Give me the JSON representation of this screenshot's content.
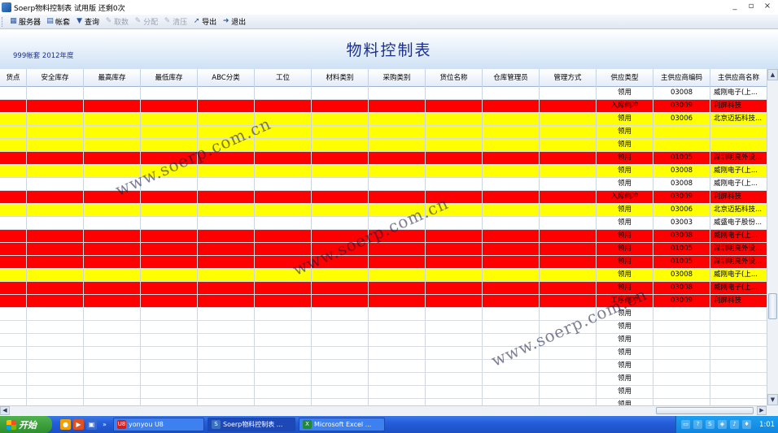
{
  "window": {
    "title": "Soerp物料控制表  试用版  还剩0次",
    "minimize": "_",
    "restore": "▫",
    "close": "×"
  },
  "toolbar": {
    "items": [
      {
        "label": "服务器",
        "icon": "server-icon",
        "glyph": "▦",
        "enabled": true
      },
      {
        "label": "帐套",
        "icon": "account-book-icon",
        "glyph": "▤",
        "enabled": true
      },
      {
        "label": "查询",
        "icon": "filter-icon",
        "glyph": "▼",
        "enabled": true
      },
      {
        "label": "取数",
        "icon": "fetch-data-icon",
        "glyph": "✎",
        "enabled": false
      },
      {
        "label": "分配",
        "icon": "allocate-icon",
        "glyph": "✎",
        "enabled": false
      },
      {
        "label": "清压",
        "icon": "clear-icon",
        "glyph": "✎",
        "enabled": false
      },
      {
        "label": "导出",
        "icon": "export-icon",
        "glyph": "➚",
        "enabled": true
      },
      {
        "label": "退出",
        "icon": "exit-icon",
        "glyph": "➜",
        "enabled": true
      }
    ]
  },
  "report": {
    "title": "物料控制表",
    "subtitle": "999帐套 2012年度"
  },
  "grid": {
    "columns": [
      "货点",
      "安全库存",
      "最高库存",
      "最低库存",
      "ABC分类",
      "工位",
      "材料类别",
      "采购类别",
      "货位名称",
      "仓库管理员",
      "管理方式",
      "供应类型",
      "主供应商编码",
      "主供应商名称"
    ],
    "rows": [
      {
        "color": "white",
        "supply_type": "领用",
        "vendor_code": "03008",
        "vendor_name": "威刚电子(上..."
      },
      {
        "color": "red",
        "supply_type": "入库倒冲",
        "vendor_code": "03009",
        "vendor_name": "利屏科技"
      },
      {
        "color": "yellow",
        "supply_type": "领用",
        "vendor_code": "03006",
        "vendor_name": "北京迈拓科技..."
      },
      {
        "color": "yellow",
        "supply_type": "领用",
        "vendor_code": "",
        "vendor_name": ""
      },
      {
        "color": "yellow",
        "supply_type": "领用",
        "vendor_code": "",
        "vendor_name": ""
      },
      {
        "color": "red",
        "supply_type": "领用",
        "vendor_code": "01005",
        "vendor_name": "深圳明亮外设..."
      },
      {
        "color": "yellow",
        "supply_type": "领用",
        "vendor_code": "03008",
        "vendor_name": "威刚电子(上..."
      },
      {
        "color": "white",
        "supply_type": "领用",
        "vendor_code": "03008",
        "vendor_name": "威刚电子(上..."
      },
      {
        "color": "red",
        "supply_type": "入库倒冲",
        "vendor_code": "03009",
        "vendor_name": "利屏科技"
      },
      {
        "color": "yellow",
        "supply_type": "领用",
        "vendor_code": "03006",
        "vendor_name": "北京迈拓科技..."
      },
      {
        "color": "white",
        "supply_type": "领用",
        "vendor_code": "03003",
        "vendor_name": "威盛电子股份..."
      },
      {
        "color": "red",
        "supply_type": "领用",
        "vendor_code": "03008",
        "vendor_name": "威刚电子(上..."
      },
      {
        "color": "red",
        "supply_type": "领用",
        "vendor_code": "01005",
        "vendor_name": "深圳明亮外设..."
      },
      {
        "color": "red",
        "supply_type": "领用",
        "vendor_code": "01005",
        "vendor_name": "深圳明亮外设..."
      },
      {
        "color": "yellow",
        "supply_type": "领用",
        "vendor_code": "03008",
        "vendor_name": "威刚电子(上..."
      },
      {
        "color": "red",
        "supply_type": "领用",
        "vendor_code": "03008",
        "vendor_name": "威刚电子(上..."
      },
      {
        "color": "red",
        "supply_type": "工序倒冲",
        "vendor_code": "03009",
        "vendor_name": "利屏科技"
      },
      {
        "color": "white",
        "supply_type": "领用",
        "vendor_code": "",
        "vendor_name": ""
      },
      {
        "color": "white",
        "supply_type": "领用",
        "vendor_code": "",
        "vendor_name": ""
      },
      {
        "color": "white",
        "supply_type": "领用",
        "vendor_code": "",
        "vendor_name": ""
      },
      {
        "color": "white",
        "supply_type": "领用",
        "vendor_code": "",
        "vendor_name": ""
      },
      {
        "color": "white",
        "supply_type": "领用",
        "vendor_code": "",
        "vendor_name": ""
      },
      {
        "color": "white",
        "supply_type": "领用",
        "vendor_code": "",
        "vendor_name": ""
      },
      {
        "color": "white",
        "supply_type": "领用",
        "vendor_code": "",
        "vendor_name": ""
      },
      {
        "color": "white",
        "supply_type": "领用",
        "vendor_code": "",
        "vendor_name": ""
      }
    ]
  },
  "watermark": "www.soerp.com.cn",
  "scrollbar": {
    "up": "▲",
    "down": "▼",
    "left": "◀",
    "right": "▶"
  },
  "taskbar": {
    "start_label": "开始",
    "quick_launch_more": "»",
    "tasks": [
      {
        "label": "yonyou U8",
        "icon": "u8-app-icon",
        "glyph": "U8"
      },
      {
        "label": "Soerp物料控制表 ...",
        "icon": "soerp-app-icon",
        "glyph": "S"
      },
      {
        "label": "Microsoft Excel ...",
        "icon": "excel-app-icon",
        "glyph": "X"
      }
    ],
    "clock": "1:01"
  },
  "colors": {
    "red_row": "#ff0000",
    "yellow_row": "#ffff00",
    "title": "#1a2f8f",
    "taskbar": "#245edb"
  }
}
